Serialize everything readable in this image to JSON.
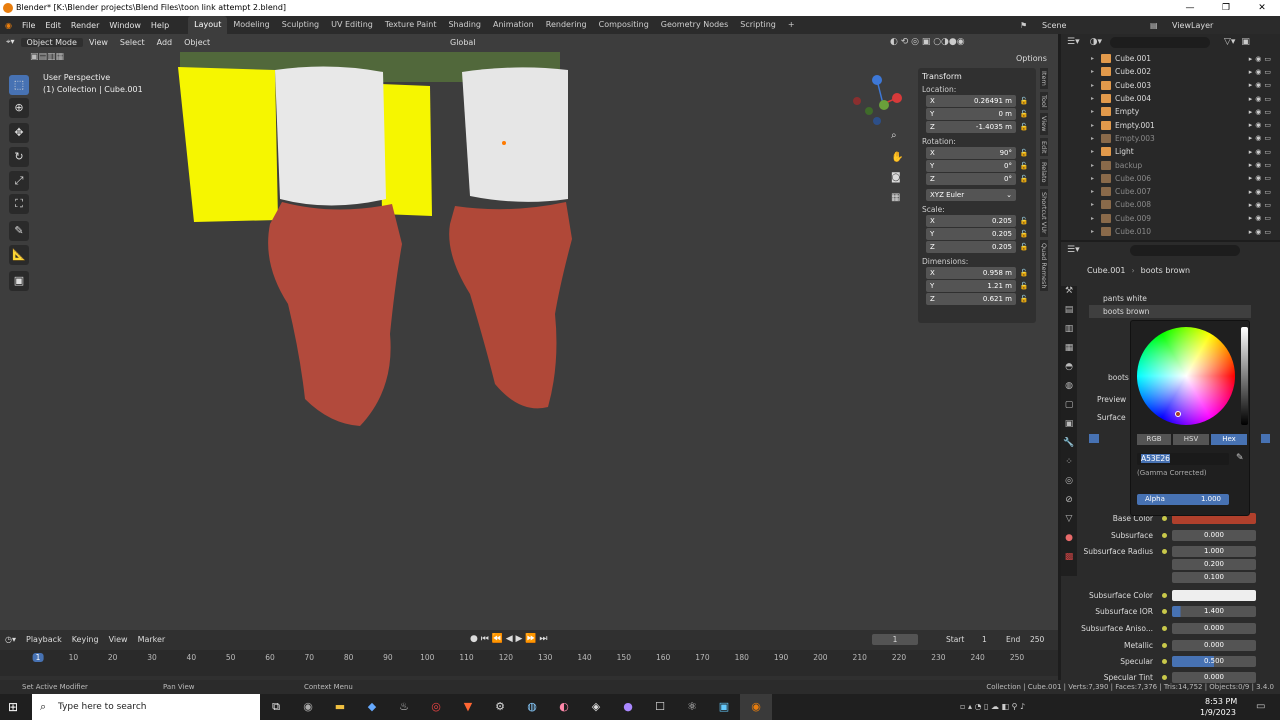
{
  "window": {
    "title": "Blender* [K:\\Blender projects\\Blend Files\\toon link attempt 2.blend]",
    "controls": [
      "—",
      "❐",
      "✕"
    ]
  },
  "menu": [
    "File",
    "Edit",
    "Render",
    "Window",
    "Help"
  ],
  "workspaces": [
    "Layout",
    "Modeling",
    "Sculpting",
    "UV Editing",
    "Texture Paint",
    "Shading",
    "Animation",
    "Rendering",
    "Compositing",
    "Geometry Nodes",
    "Scripting"
  ],
  "scene": {
    "label": "Scene",
    "view_layer": "ViewLayer"
  },
  "viewport": {
    "header": [
      "Object Mode",
      "View",
      "Select",
      "Add",
      "Object"
    ],
    "orientation": "Global",
    "options": "Options",
    "perspective": "User Perspective",
    "collection": "(1) Collection | Cube.001",
    "colors": {
      "bg": "#3d3d3d",
      "yellow": "#ffff00",
      "white": "#e9e9e9",
      "boot": "#b24a3c"
    }
  },
  "transform": {
    "title": "Transform",
    "location_label": "Location:",
    "location": [
      {
        "axis": "X",
        "value": "0.26491 m"
      },
      {
        "axis": "Y",
        "value": "0 m"
      },
      {
        "axis": "Z",
        "value": "-1.4035 m"
      }
    ],
    "rotation_label": "Rotation:",
    "rotation": [
      {
        "axis": "X",
        "value": "90°"
      },
      {
        "axis": "Y",
        "value": "0°"
      },
      {
        "axis": "Z",
        "value": "0°"
      }
    ],
    "rotation_mode": "XYZ Euler",
    "scale_label": "Scale:",
    "scale": [
      {
        "axis": "X",
        "value": "0.205"
      },
      {
        "axis": "Y",
        "value": "0.205"
      },
      {
        "axis": "Z",
        "value": "0.205"
      }
    ],
    "dimensions_label": "Dimensions:",
    "dimensions": [
      {
        "axis": "X",
        "value": "0.958 m"
      },
      {
        "axis": "Y",
        "value": "1.21 m"
      },
      {
        "axis": "Z",
        "value": "0.621 m"
      }
    ]
  },
  "npanel_tabs": [
    "Item",
    "Tool",
    "View",
    "Edit",
    "Relato",
    "Shortcut VUr",
    "Quad Remesh"
  ],
  "outliner": {
    "items": [
      {
        "name": "Cube.001",
        "dim": false
      },
      {
        "name": "Cube.002",
        "dim": false
      },
      {
        "name": "Cube.003",
        "dim": false
      },
      {
        "name": "Cube.004",
        "dim": false
      },
      {
        "name": "Empty",
        "dim": false
      },
      {
        "name": "Empty.001",
        "dim": false
      },
      {
        "name": "Empty.003",
        "dim": true
      },
      {
        "name": "Light",
        "dim": false
      },
      {
        "name": "backup",
        "dim": true
      },
      {
        "name": "Cube.006",
        "dim": true
      },
      {
        "name": "Cube.007",
        "dim": true
      },
      {
        "name": "Cube.008",
        "dim": true
      },
      {
        "name": "Cube.009",
        "dim": true
      },
      {
        "name": "Cube.010",
        "dim": true
      }
    ]
  },
  "properties": {
    "object": "Cube.001",
    "material": "boots brown",
    "slots": [
      "pants white",
      "boots brown"
    ],
    "mat_field": "boots",
    "preview": "Preview",
    "surface": "Surface",
    "rows": [
      {
        "label": "Base Color",
        "value": ""
      },
      {
        "label": "Subsurface",
        "value": "0.000"
      },
      {
        "label": "Subsurface Radius",
        "value": "1.000"
      },
      {
        "label": "",
        "value": "0.200"
      },
      {
        "label": "",
        "value": "0.100"
      },
      {
        "label": "Subsurface Color",
        "value": ""
      },
      {
        "label": "Subsurface IOR",
        "value": "1.400"
      },
      {
        "label": "Subsurface Aniso...",
        "value": "0.000"
      },
      {
        "label": "Metallic",
        "value": "0.000"
      },
      {
        "label": "Specular",
        "value": "0.500"
      },
      {
        "label": "Specular Tint",
        "value": "0.000"
      }
    ]
  },
  "color_picker": {
    "tabs": [
      "RGB",
      "HSV",
      "Hex"
    ],
    "hex": "A53E26",
    "note": "(Gamma Corrected)",
    "alpha_label": "Alpha",
    "alpha_value": "1.000",
    "base_color": "#b0402c"
  },
  "timeline": {
    "header": [
      "Playback",
      "Keying",
      "View",
      "Marker"
    ],
    "frame": "1",
    "start_label": "Start",
    "start": "1",
    "end_label": "End",
    "end": "250",
    "ticks": [
      "1",
      "10",
      "20",
      "30",
      "40",
      "50",
      "60",
      "70",
      "80",
      "90",
      "100",
      "110",
      "120",
      "130",
      "140",
      "150",
      "160",
      "170",
      "180",
      "190",
      "200",
      "210",
      "220",
      "230",
      "240",
      "250"
    ]
  },
  "status": {
    "left": "Set Active Modifier",
    "mid": "Pan View",
    "ctx": "Context Menu",
    "right": "Collection | Cube.001 | Verts:7,390 | Faces:7,376 | Tris:14,752 | Objects:0/9 | 3.4.0"
  },
  "taskbar": {
    "search": "Type here to search",
    "time": "8:53 PM",
    "date": "1/9/2023"
  }
}
